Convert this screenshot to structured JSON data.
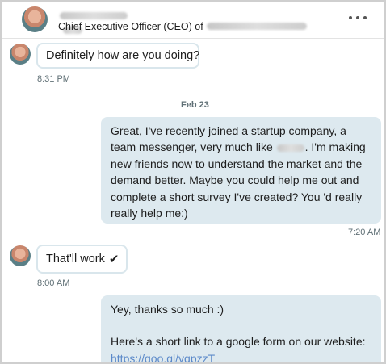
{
  "header": {
    "title_prefix": "Chief Executive Officer (CEO) of",
    "more_icon": "more-horizontal-icon"
  },
  "messages": [
    {
      "direction": "in",
      "text": "Definitely how are you doing?",
      "time": "8:31 PM"
    },
    {
      "date_divider": "Feb 23"
    },
    {
      "direction": "out",
      "text_part1": "Great, I've recently joined a startup company, a team messenger, very much like",
      "text_part2": ". I'm making new friends now to understand the market and the demand better. Maybe you could help me out and complete a short survey I've created? You 'd really really help me:)",
      "time": "7:20 AM"
    },
    {
      "direction": "in",
      "text": "That'll work",
      "checkmark": "✔",
      "time": "8:00 AM"
    },
    {
      "direction": "out",
      "line1": "Yey, thanks so much :)",
      "line2": "Here's a short link to a google form on our website:",
      "link": "https://goo.gl/yqpzzT"
    }
  ]
}
